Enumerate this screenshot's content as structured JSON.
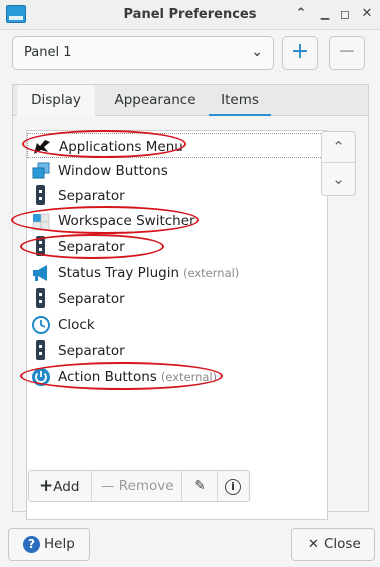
{
  "window": {
    "title": "Panel Preferences",
    "icon": "panel-app-icon",
    "controls": [
      "✕",
      "◻",
      "▁",
      "⌃"
    ]
  },
  "panel_selector": {
    "selected": "Panel 1",
    "add_label": "+",
    "remove_label": "−"
  },
  "tabs": [
    "Display",
    "Appearance",
    "Items"
  ],
  "active_tab": "Items",
  "items": [
    {
      "label": "Applications Menu",
      "note": "",
      "icon": "applications-menu-icon",
      "highlighted": true
    },
    {
      "label": "Window Buttons",
      "note": "",
      "icon": "window-buttons-icon",
      "highlighted": false
    },
    {
      "label": "Separator",
      "note": "",
      "icon": "separator-icon",
      "highlighted": false
    },
    {
      "label": "Workspace Switcher",
      "note": "",
      "icon": "workspace-switcher-icon",
      "highlighted": true
    },
    {
      "label": "Separator",
      "note": "",
      "icon": "separator-icon",
      "highlighted": true
    },
    {
      "label": "Status Tray Plugin",
      "note": "(external)",
      "icon": "megaphone-icon",
      "highlighted": false
    },
    {
      "label": "Separator",
      "note": "",
      "icon": "separator-icon",
      "highlighted": false
    },
    {
      "label": "Clock",
      "note": "",
      "icon": "clock-icon",
      "highlighted": false
    },
    {
      "label": "Separator",
      "note": "",
      "icon": "separator-icon",
      "highlighted": false
    },
    {
      "label": "Action Buttons",
      "note": "(external)",
      "icon": "power-icon",
      "highlighted": true
    }
  ],
  "reorder": {
    "up": "⌃",
    "down": "⌄"
  },
  "toolbar": {
    "add_label": "Add",
    "add_glyph": "+",
    "remove_label": "Remove",
    "remove_glyph": "—",
    "edit_glyph": "✎",
    "about_glyph": "i"
  },
  "footer": {
    "help_label": "Help",
    "help_glyph": "?",
    "close_label": "Close",
    "close_glyph": "✕"
  },
  "colors": {
    "accent": "#2b8fd1",
    "highlight_ring": "#d4151c",
    "icon_blue": "#1e88c8"
  }
}
